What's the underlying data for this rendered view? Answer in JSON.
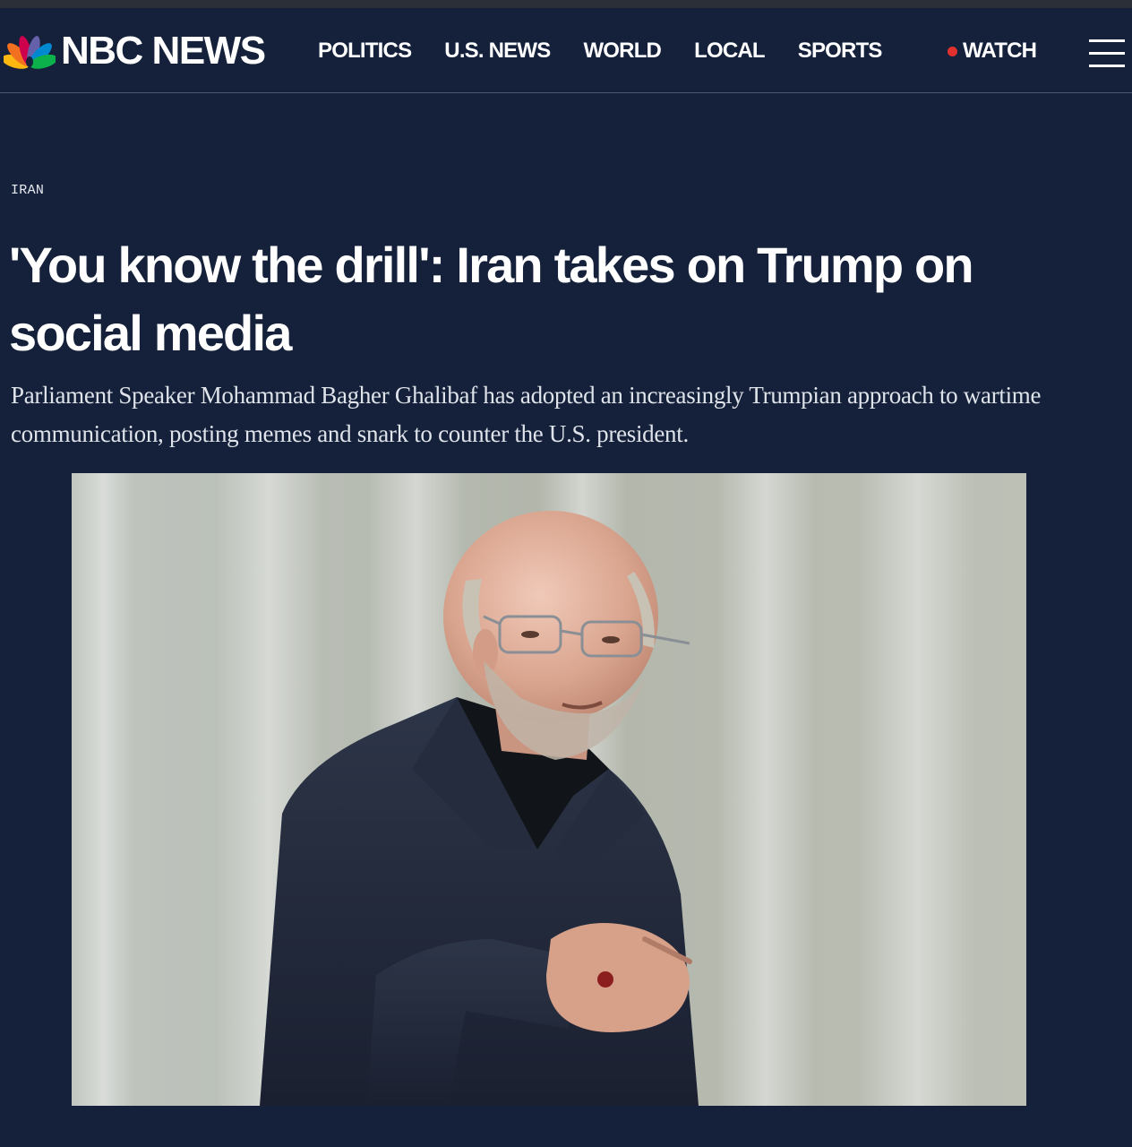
{
  "brand": {
    "name": "NBC NEWS",
    "peacock_colors": [
      "#fcb711",
      "#f37021",
      "#cc004c",
      "#6460aa",
      "#0089d0",
      "#0db14b"
    ]
  },
  "nav": {
    "items": [
      "POLITICS",
      "U.S. NEWS",
      "WORLD",
      "LOCAL",
      "SPORTS"
    ],
    "watch_label": "WATCH",
    "menu_icon": "hamburger-menu-icon"
  },
  "article": {
    "category": "IRAN",
    "headline": "'You know the drill': Iran takes on Trump on social media",
    "dek": "Parliament Speaker Mohammad Bagher Ghalibaf has adopted an increasingly Trumpian approach to wartime communication, posting memes and snark to counter the U.S. president."
  },
  "colors": {
    "background": "#15213a",
    "watch_dot": "#e0312f"
  }
}
